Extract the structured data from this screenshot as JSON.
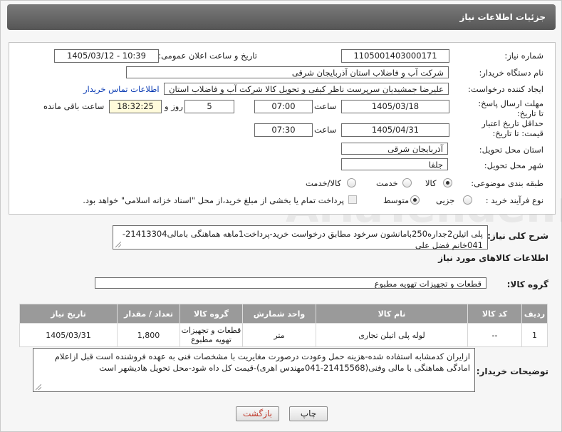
{
  "header": {
    "title": "جزئیات اطلاعات نیاز"
  },
  "form": {
    "need_number_label": "شماره نیاز:",
    "need_number": "1105001403000171",
    "announce_label": "تاریخ و ساعت اعلان عمومی:",
    "announce_value": "1405/03/12 - 10:39",
    "buyer_org_label": "نام دستگاه خریدار:",
    "buyer_org": "شرکت آب و فاضلاب استان آذربایجان شرقی",
    "creator_label": "ایجاد کننده درخواست:",
    "creator": "علیرضا جمشیدیان سرپرست ناظر کیفی و تحویل کالا شرکت آب و فاضلاب استان",
    "contact_link": "اطلاعات تماس خریدار",
    "reply_deadline_label": "مهلت ارسال پاسخ: تا تاریخ:",
    "reply_date": "1405/03/18",
    "time_label": "ساعت",
    "reply_time": "07:00",
    "days_value": "5",
    "days_label": "روز و",
    "remaining_value": "18:32:25",
    "remaining_label": "ساعت باقی مانده",
    "price_validity_label": "حداقل تاریخ اعتبار قیمت: تا تاریخ:",
    "price_date": "1405/04/31",
    "price_time_label": "ساعت",
    "price_time": "07:30",
    "province_label": "استان محل تحویل:",
    "province": "آذربایجان شرقی",
    "city_label": "شهر محل تحویل:",
    "city": "جلفا",
    "category_label": "طبقه بندی موضوعی:",
    "category_options": [
      "کالا",
      "خدمت",
      "کالا/خدمت"
    ],
    "category_selected": "کالا",
    "process_label": "نوع فرآیند خرید :",
    "process_options": [
      "جزیی",
      "متوسط"
    ],
    "process_selected": "متوسط",
    "payment_note": "پرداخت تمام یا بخشی از مبلغ خرید،از محل \"اسناد خزانه اسلامی\" خواهد بود."
  },
  "summary": {
    "label": "شرح کلی نیاز:",
    "text": "پلی اتیلن2جداره250بامانشون سرخود مطابق درخواست خرید-پرداخت1ماهه هماهنگی بامالی21413304-041خانم فضل علی"
  },
  "goods": {
    "section_title": "اطلاعات کالاهای مورد نیاز",
    "group_label": "گروه کالا:",
    "group_value": "قطعات و تجهیزات تهویه مطبوع",
    "columns": [
      "ردیف",
      "کد کالا",
      "نام کالا",
      "واحد شمارش",
      "گروه کالا",
      "تعداد / مقدار",
      "تاریخ نیاز"
    ],
    "rows": [
      {
        "row": "1",
        "code": "--",
        "name": "لوله پلی اتیلن تجاری",
        "unit": "متر",
        "group": "قطعات و تجهیزات تهویه مطبوع",
        "qty": "1,800",
        "date": "1405/03/31"
      }
    ]
  },
  "buyer_notes": {
    "label": "توضیحات خریدار:",
    "text": "ازایران کدمشابه استفاده شده-هزینه حمل وعودت درصورت مغایریت با مشخصات فنی به عهده فروشنده است قبل ازاعلام امادگی هماهنگی با مالی وفنی(21415568-041مهندس اهری)-قیمت کل داه شود-محل تحویل هادیشهر است"
  },
  "buttons": {
    "print": "چاپ",
    "back": "بازگشت"
  },
  "watermark": "AriaTender.net"
}
